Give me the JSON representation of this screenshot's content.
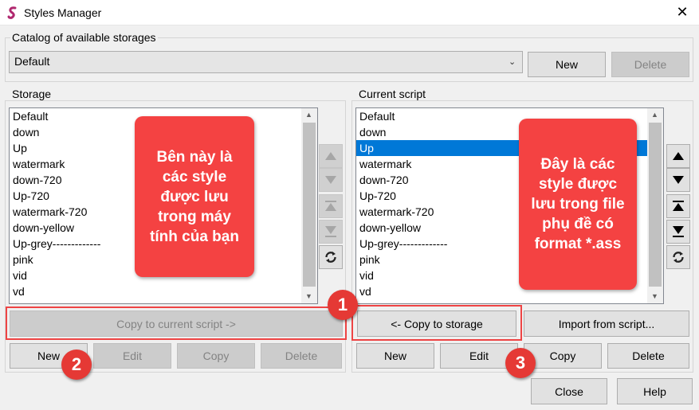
{
  "window": {
    "title": "Styles Manager",
    "close_glyph": "✕"
  },
  "catalog": {
    "label": "Catalog of available storages",
    "selected": "Default",
    "new_label": "New",
    "delete_label": "Delete"
  },
  "storage": {
    "label": "Storage",
    "items": [
      "Default",
      "down",
      "Up",
      "watermark",
      "down-720",
      "Up-720",
      "watermark-720",
      "down-yellow",
      "Up-grey-------------",
      "pink",
      "vid",
      "vd"
    ],
    "copy_to_script_label": "Copy to current script ->",
    "new_label": "New",
    "edit_label": "Edit",
    "copy_label": "Copy",
    "delete_label": "Delete"
  },
  "current_script": {
    "label": "Current script",
    "items": [
      "Default",
      "down",
      "Up",
      "watermark",
      "down-720",
      "Up-720",
      "watermark-720",
      "down-yellow",
      "Up-grey-------------",
      "pink",
      "vid",
      "vd"
    ],
    "selected_index": 2,
    "copy_to_storage_label": "<- Copy to storage",
    "import_label": "Import from script...",
    "new_label": "New",
    "edit_label": "Edit",
    "copy_label": "Copy",
    "delete_label": "Delete"
  },
  "footer": {
    "close_label": "Close",
    "help_label": "Help"
  },
  "annotations": {
    "left_callout": "Bên này là các style được lưu trong máy tính của bạn",
    "right_callout": "Đây là các style được lưu trong file phụ đề có format *.ass",
    "badge1": "1",
    "badge2": "2",
    "badge3": "3"
  },
  "colors": {
    "accent": "#f44242",
    "selection": "#0078d7"
  }
}
